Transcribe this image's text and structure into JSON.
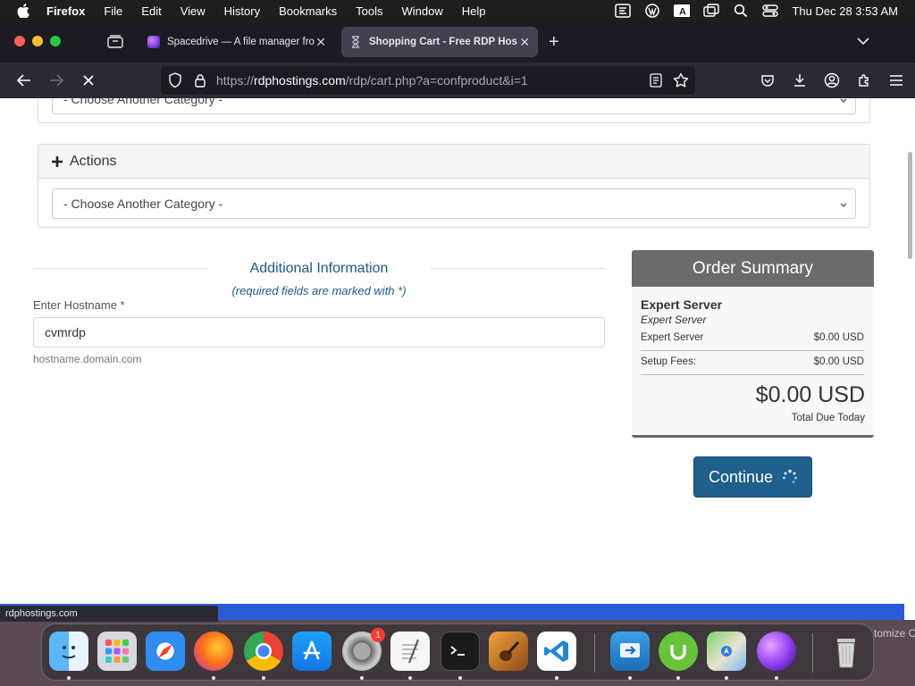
{
  "menubar": {
    "app_name": "Firefox",
    "items": [
      "File",
      "Edit",
      "View",
      "History",
      "Bookmarks",
      "Tools",
      "Window",
      "Help"
    ],
    "clock": "Thu Dec 28  3:53 AM",
    "input_source": "A"
  },
  "tabs": [
    {
      "title": "Spacedrive — A file manager fro",
      "favicon_color": "#7b3fe4"
    },
    {
      "title": "Shopping Cart - Free RDP Hosti",
      "favicon_color": "#9a9aa6",
      "active": true
    }
  ],
  "urlbar": {
    "url_prefix": "https://",
    "url_domain": "rdphostings.com",
    "url_path": "/rdp/cart.php?a=confproduct&i=1"
  },
  "page": {
    "category_select_top": "- Choose Another Category -",
    "actions_label": "Actions",
    "category_select_actions": "- Choose Another Category -",
    "additional_info_title": "Additional Information",
    "required_note": "(required fields are marked with *)",
    "hostname_label": "Enter Hostname *",
    "hostname_value": "cvmrdp",
    "hostname_help": "hostname.domain.com"
  },
  "order_summary": {
    "title": "Order Summary",
    "product_name": "Expert Server",
    "product_group": "Expert Server",
    "lines": [
      {
        "label": "Expert Server",
        "amount": "$0.00 USD"
      },
      {
        "label": "Setup Fees:",
        "amount": "$0.00 USD"
      }
    ],
    "total": "$0.00 USD",
    "total_label": "Total Due Today"
  },
  "continue_label": "Continue",
  "status_bar_url": "rdphostings.com",
  "dock": {
    "apps": [
      "Finder",
      "Launchpad",
      "Safari",
      "Firefox",
      "Chrome",
      "App Store",
      "System Settings",
      "TextEdit",
      "Terminal",
      "GarageBand",
      "Visual Studio Code",
      "Migration Assistant",
      "uTorrent",
      "Maps",
      "Spacedrive",
      "Trash"
    ],
    "settings_badge": "1",
    "customize_text": "tomize C"
  },
  "colors": {
    "accent_blue": "#1e5f8c",
    "heading_blue": "#1d5a82",
    "summary_header": "#6b6b6b"
  }
}
